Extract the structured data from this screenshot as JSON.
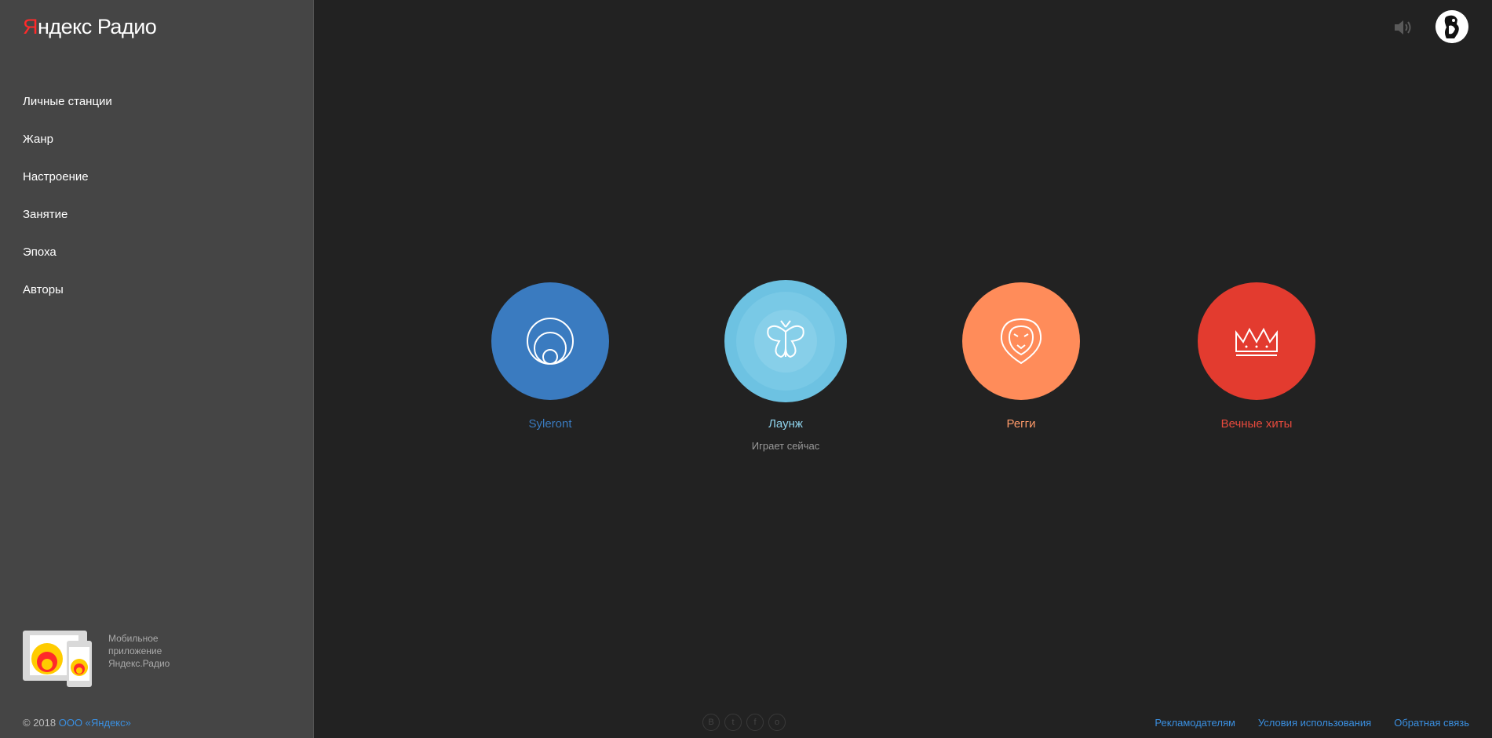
{
  "logo": {
    "first": "Я",
    "rest": "ндекс",
    "radio": "Радио"
  },
  "nav": [
    {
      "label": "Личные станции"
    },
    {
      "label": "Жанр"
    },
    {
      "label": "Настроение"
    },
    {
      "label": "Занятие"
    },
    {
      "label": "Эпоха"
    },
    {
      "label": "Авторы"
    }
  ],
  "promo": {
    "line1": "Мобильное",
    "line2": "приложение",
    "line3": "Яндекс.Радио"
  },
  "copyright": {
    "text": "© 2018 ",
    "link": "ООО «Яндекс»"
  },
  "header": {
    "speaker_icon": "speaker-icon",
    "avatar_icon": "user-avatar"
  },
  "stations": [
    {
      "name": "Syleront",
      "color": "#3a7bc0",
      "icon": "circles-icon",
      "status": ""
    },
    {
      "name": "Лаунж",
      "color": "#6dc2e2",
      "icon": "butterfly-icon",
      "status": "Играет сейчас"
    },
    {
      "name": "Регги",
      "color": "#ff8c5a",
      "icon": "lion-icon",
      "status": ""
    },
    {
      "name": "Вечные хиты",
      "color": "#e33b2f",
      "icon": "crown-icon",
      "status": ""
    }
  ],
  "social": [
    "vk-icon",
    "twitter-icon",
    "facebook-icon",
    "odnoklassniki-icon"
  ],
  "footer_links": [
    {
      "label": "Рекламодателям"
    },
    {
      "label": "Условия использования"
    },
    {
      "label": "Обратная связь"
    }
  ]
}
